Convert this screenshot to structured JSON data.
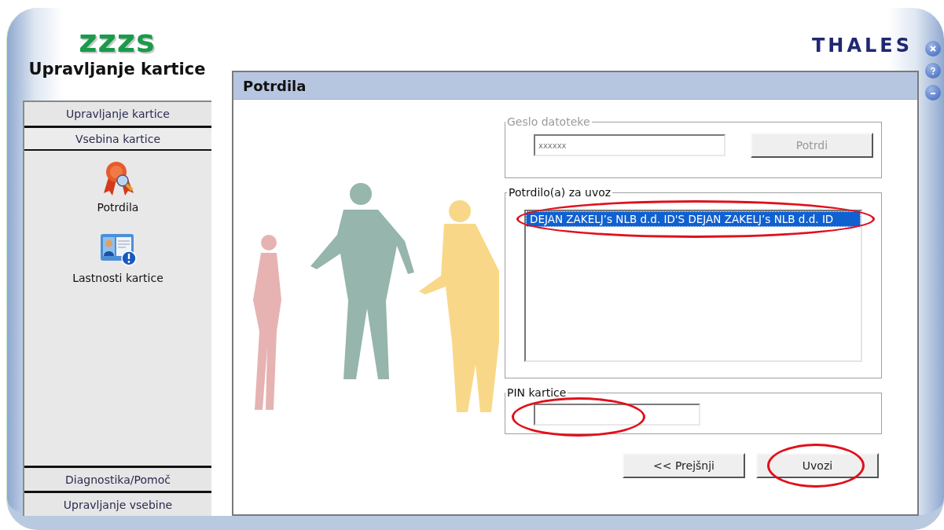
{
  "app": {
    "logo": "zzzs",
    "title": "Upravljanje kartice",
    "vendor_logo": "THALES"
  },
  "window_buttons": [
    {
      "kind": "close"
    },
    {
      "kind": "help"
    },
    {
      "kind": "minimize"
    }
  ],
  "sidebar": {
    "sections": [
      {
        "label": "Upravljanje kartice",
        "expanded": false
      },
      {
        "label": "Vsebina kartice",
        "expanded": true,
        "items": [
          {
            "label": "Potrdila",
            "kind": "certificate"
          },
          {
            "label": "Lastnosti kartice",
            "kind": "card"
          }
        ]
      },
      {
        "label": "Diagnostika/Pomoč",
        "expanded": false
      },
      {
        "label": "Upravljanje vsebine",
        "expanded": false
      }
    ]
  },
  "page": {
    "title": "Potrdila"
  },
  "password_group": {
    "legend": "Geslo datoteke",
    "disabled": true,
    "value": "xxxxxx",
    "button": "Potrdi"
  },
  "import_group": {
    "legend": "Potrdilo(a) za uvoz",
    "items": [
      {
        "label": "DEJAN ZAKELJ’s NLB d.d. ID'S DEJAN ZAKELJ’s NLB d.d. ID",
        "selected": true,
        "annotated": true
      }
    ]
  },
  "pin_group": {
    "legend": "PIN kartice",
    "annotated": true
  },
  "buttons": [
    {
      "label": "<< Prejšnji",
      "annotated": false
    },
    {
      "label": "Uvozi",
      "annotated": true
    }
  ]
}
